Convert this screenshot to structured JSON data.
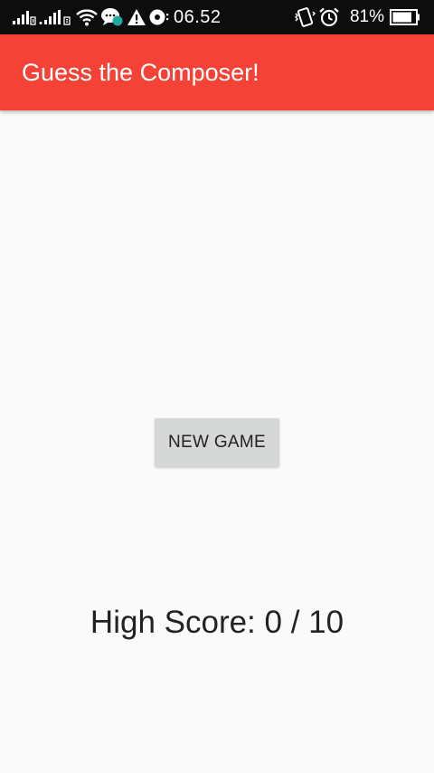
{
  "status_bar": {
    "icons": [
      "signal-sim1-icon",
      "signal-sim2-icon",
      "wifi-icon",
      "chat-notification-icon",
      "warning-icon",
      "media-icon",
      "vibrate-icon",
      "alarm-icon",
      "battery-icon"
    ],
    "time": "06.52",
    "battery_percent": "81%"
  },
  "app_bar": {
    "title": "Guess the Composer!",
    "color": "#f44336"
  },
  "main": {
    "new_game_label": "NEW GAME",
    "high_score_text": "High Score: 0 / 10"
  }
}
